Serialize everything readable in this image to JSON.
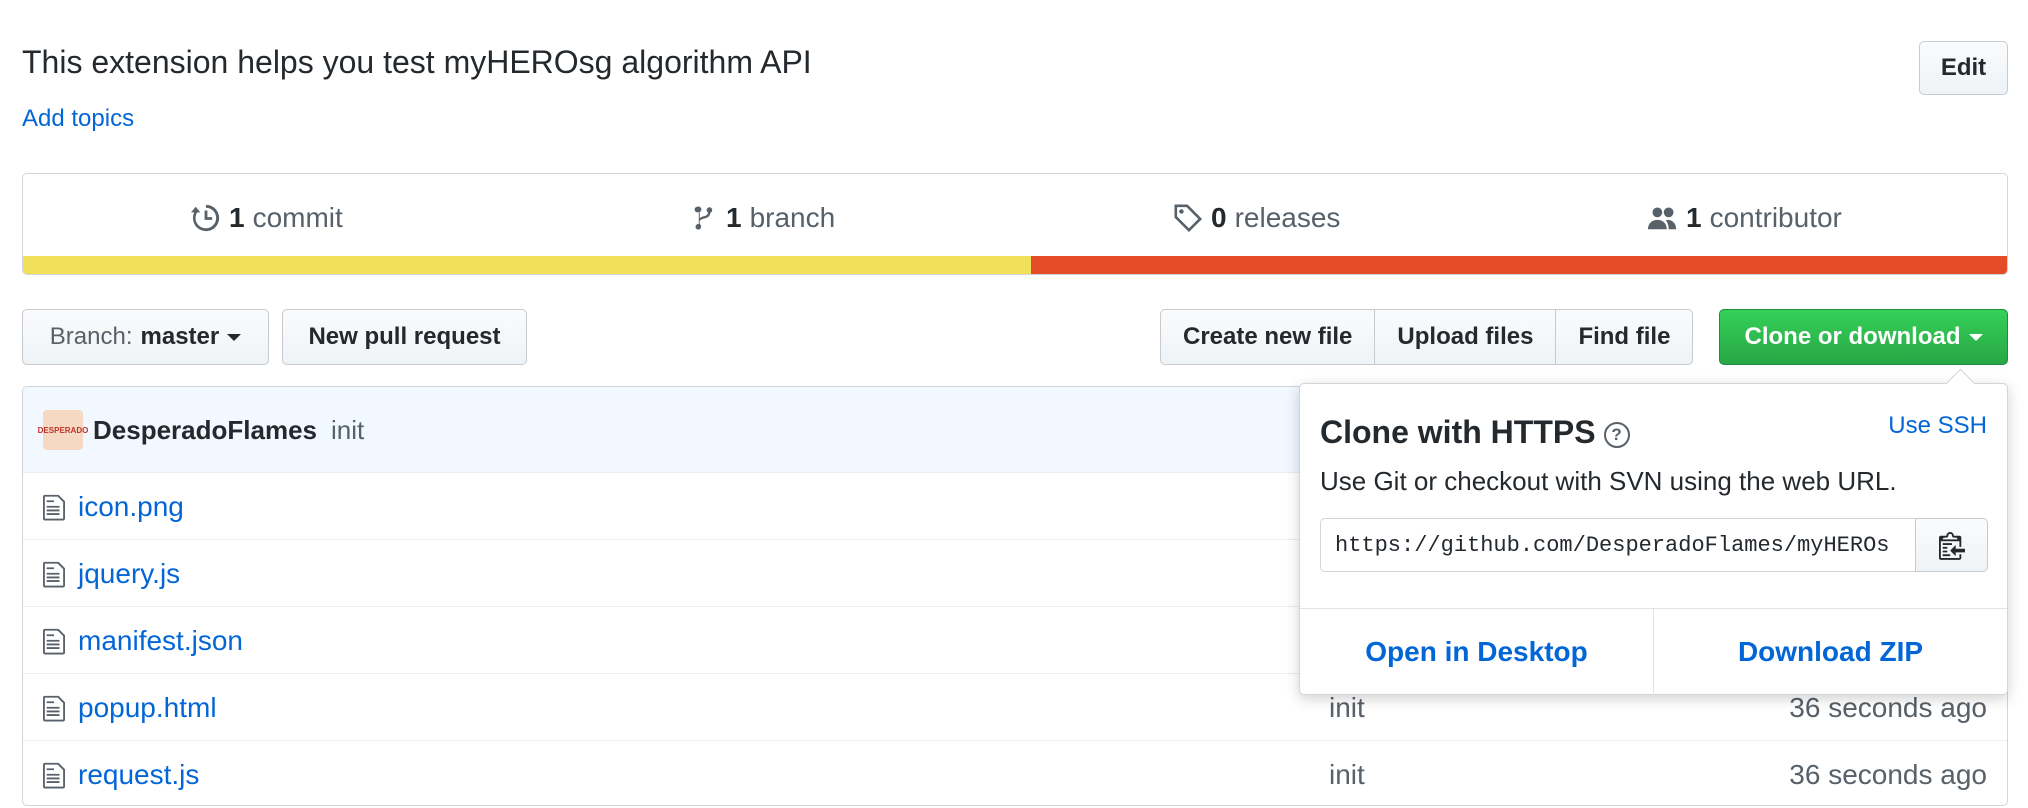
{
  "repo": {
    "description": "This extension helps you test myHEROsg algorithm API",
    "add_topics": "Add topics",
    "edit_label": "Edit"
  },
  "summary": {
    "commits": {
      "count": "1",
      "label": "commit"
    },
    "branches": {
      "count": "1",
      "label": "branch"
    },
    "releases": {
      "count": "0",
      "label": "releases"
    },
    "contributors": {
      "count": "1",
      "label": "contributor"
    },
    "language_bar": [
      {
        "color": "#f1e05a",
        "fraction": 0.508
      },
      {
        "color": "#e34c26",
        "fraction": 0.492
      }
    ]
  },
  "toolbar": {
    "branch_prefix": "Branch:",
    "branch_name": "master",
    "new_pr": "New pull request",
    "create_file": "Create new file",
    "upload_files": "Upload files",
    "find_file": "Find file",
    "clone": "Clone or download"
  },
  "latest_commit": {
    "author": "DesperadoFlames",
    "message": "init",
    "avatar_text": "DESPERADO"
  },
  "files": [
    {
      "name": "icon.png",
      "message": "",
      "age": ""
    },
    {
      "name": "jquery.js",
      "message": "",
      "age": ""
    },
    {
      "name": "manifest.json",
      "message": "",
      "age": ""
    },
    {
      "name": "popup.html",
      "message": "init",
      "age": "36 seconds ago"
    },
    {
      "name": "request.js",
      "message": "init",
      "age": "36 seconds ago"
    }
  ],
  "clone_popover": {
    "title": "Clone with HTTPS",
    "help_glyph": "?",
    "use_ssh": "Use SSH",
    "description": "Use Git or checkout with SVN using the web URL.",
    "url": "https://github.com/DesperadoFlames/myHEROs",
    "open_desktop": "Open in Desktop",
    "download_zip": "Download ZIP"
  },
  "colors": {
    "link": "#0366d6",
    "primary_green": "#28a745",
    "commit_row_bg": "#f1f8ff"
  },
  "icons": [
    "history-icon",
    "branch-icon",
    "tag-icon",
    "people-icon",
    "file-icon",
    "clipboard-icon",
    "question-icon",
    "caret-down-icon"
  ]
}
